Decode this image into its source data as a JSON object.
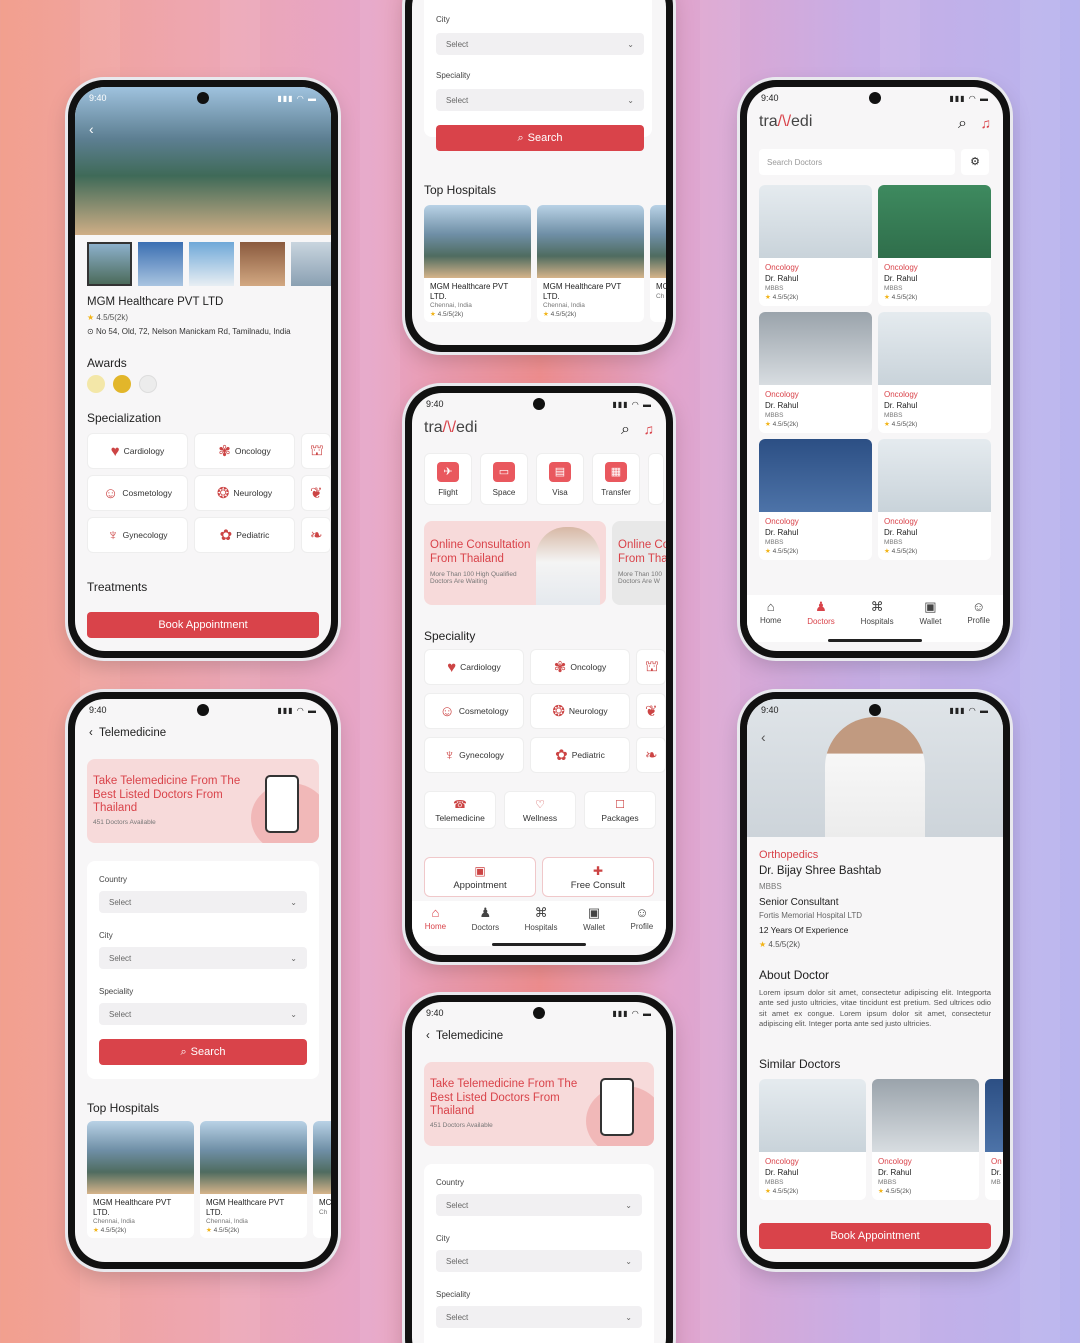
{
  "status": {
    "time": "9:40",
    "icons": "▮▮▮ ◠ ▬"
  },
  "brand": {
    "pre": "tra",
    "mark": "/\\/",
    "post": "edi"
  },
  "p1": {
    "hospital_name": "MGM Healthcare PVT LTD",
    "rating": "4.5/5(2k)",
    "address": "No 54, Old, 72, Nelson Manickam Rd, Tamilnadu, India",
    "awards_title": "Awards",
    "spec_title": "Specialization",
    "treat_title": "Treatments",
    "book": "Book Appointment"
  },
  "specs": [
    "Cardiology",
    "Oncology",
    "Cosmetology",
    "Neurology",
    "Gynecology",
    "Pediatric"
  ],
  "filters": {
    "country": "Country",
    "city": "City",
    "speciality": "Speciality",
    "select": "Select",
    "search": "Search"
  },
  "tele": {
    "title": "Telemedicine",
    "banner": "Take Telemedicine From The Best Listed Doctors From Thailand",
    "count": "451 Doctors Available"
  },
  "top_hospitals": "Top Hospitals",
  "hosp": {
    "name": "MGM Healthcare PVT LTD.",
    "loc": "Chennai, India",
    "rating": "4.5/5(2k)",
    "cut1": "MC",
    "cut2": "LTI",
    "cut3": "Ch"
  },
  "home": {
    "services": [
      "Flight",
      "Space",
      "Visa",
      "Transfer"
    ],
    "promo_title": "Online Consultation From Thailand",
    "promo_sub": "More Than 100 High Qualified Doctors Are Waiting",
    "promo_cut_title": "Online Co From Tha",
    "promo_cut_sub": "More Than 100 Doctors Are W",
    "speciality": "Speciality",
    "extras": [
      "Telemedicine",
      "Wellness",
      "Packages"
    ],
    "appt": "Appointment",
    "free": "Free Consult"
  },
  "nav": [
    "Home",
    "Doctors",
    "Hospitals",
    "Wallet",
    "Profile"
  ],
  "docs": {
    "search_ph": "Search Doctors",
    "spec": "Oncology",
    "name": "Dr. Rahul",
    "deg": "MBBS",
    "rating": "4.5/5(2k)"
  },
  "detail": {
    "spec": "Orthopedics",
    "name": "Dr. Bijay Shree Bashtab",
    "deg": "MBBS",
    "role": "Senior Consultant",
    "hospital": "Fortis Memorial Hospital LTD",
    "exp": "12 Years Of Experience",
    "rating": "4.5/5(2k)",
    "about_title": "About Doctor",
    "about": "Lorem ipsum dolor sit amet, consectetur adipiscing elit. Integporta ante sed justo ultricies, vitae tincidunt est pretium. Sed ultrices odio sit amet ex congue. Lorem ipsum dolor sit amet, consectetur adipiscing elit. Integer porta ante sed justo ultricies.",
    "similar": "Similar Doctors",
    "cut_spec": "On",
    "cut_name": "Dr.",
    "cut_deg": "MB",
    "book": "Book Appointment"
  },
  "colors": {
    "accent": "#d9434a",
    "banner": "#f7dada"
  }
}
